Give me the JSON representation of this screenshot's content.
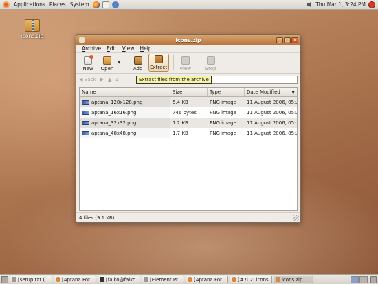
{
  "top_panel": {
    "menus": [
      "Applications",
      "Places",
      "System"
    ],
    "clock": "Thu Mar  1,  3:24 PM"
  },
  "desktop": {
    "icon_label": "icons.zip"
  },
  "window": {
    "title": "icons.zip",
    "menu": [
      "Archive",
      "Edit",
      "View",
      "Help"
    ],
    "toolbar": {
      "new": "New",
      "open": "Open",
      "add": "Add",
      "extract": "Extract",
      "view": "View",
      "stop": "Stop"
    },
    "location": {
      "back": "Back",
      "value": ""
    },
    "tooltip": "Extract files from the archive",
    "columns": {
      "name": "Name",
      "size": "Size",
      "type": "Type",
      "date": "Date Modified"
    },
    "files": [
      {
        "name": "aptana_128x128.png",
        "size": "5.4 KB",
        "type": "PNG image",
        "date": "11 August 2006, 05:..."
      },
      {
        "name": "aptana_16x16.png",
        "size": "746 bytes",
        "type": "PNG image",
        "date": "11 August 2006, 05:..."
      },
      {
        "name": "aptana_32x32.png",
        "size": "1.2 KB",
        "type": "PNG image",
        "date": "11 August 2006, 05:..."
      },
      {
        "name": "aptana_48x48.png",
        "size": "1.7 KB",
        "type": "PNG image",
        "date": "11 August 2006, 05:..."
      }
    ],
    "status": "4 files (9.1 KB)"
  },
  "taskbar": {
    "tasks": [
      {
        "label": "[setup.txt (...",
        "icon": "text-file-icon",
        "active": false
      },
      {
        "label": "[Aptana For...",
        "icon": "firefox-icon",
        "active": false
      },
      {
        "label": "[falko@falko...",
        "icon": "terminal-icon",
        "active": false
      },
      {
        "label": "[Element Pr...",
        "icon": "window-icon",
        "active": false
      },
      {
        "label": "[Aptana For...",
        "icon": "firefox-icon",
        "active": false
      },
      {
        "label": "[#702: icons...",
        "icon": "firefox-icon",
        "active": false
      },
      {
        "label": "icons.zip",
        "icon": "archive-icon",
        "active": true
      }
    ]
  }
}
